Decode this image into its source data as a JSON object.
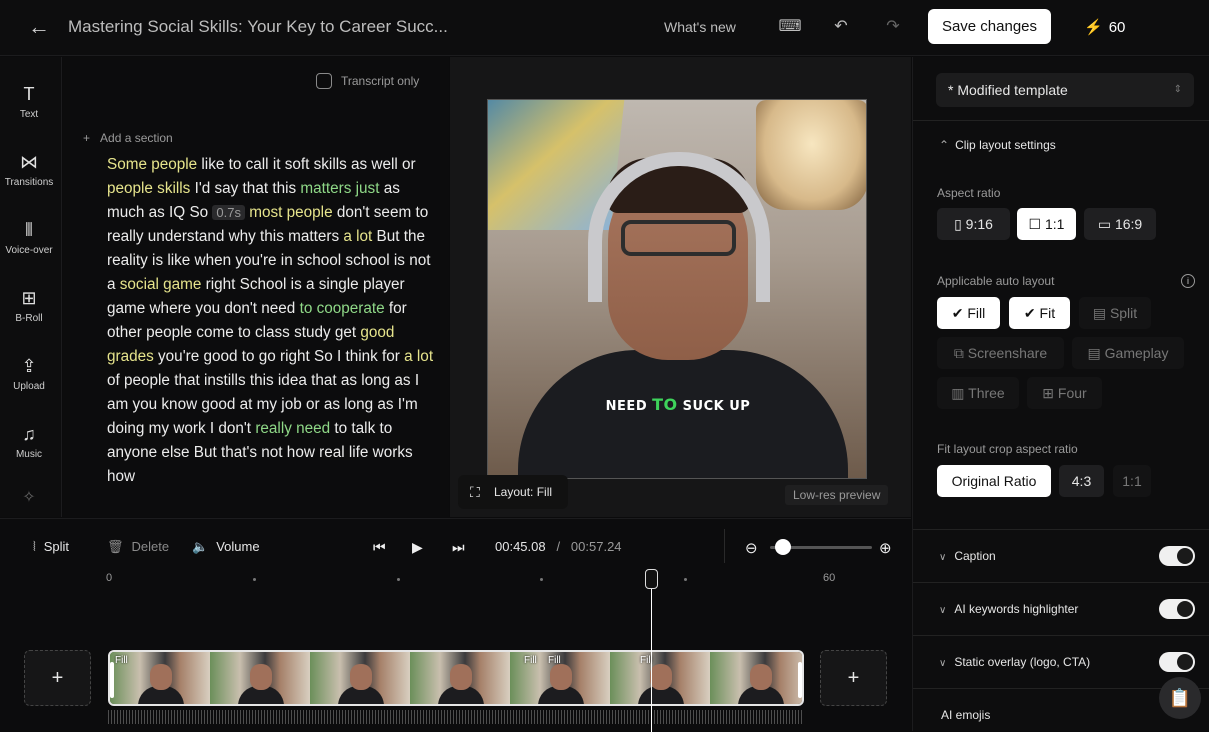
{
  "header": {
    "title": "Mastering Social Skills: Your Key to Career Succ...",
    "whats_new": "What's new",
    "save_label": "Save changes",
    "credits": "60"
  },
  "leftnav": {
    "items": [
      {
        "label": "Text",
        "icon": "T"
      },
      {
        "label": "Transitions",
        "icon": "⋈"
      },
      {
        "label": "Voice-over",
        "icon": "⦀"
      },
      {
        "label": "B-Roll",
        "icon": "⊞"
      },
      {
        "label": "Upload",
        "icon": "⇪"
      },
      {
        "label": "Music",
        "icon": "♫"
      }
    ]
  },
  "transcript": {
    "transcript_only_label": "Transcript only",
    "add_section_label": "Add a section",
    "pause_tag": "0.7s",
    "segments": [
      {
        "t": "Some people",
        "c": "y"
      },
      {
        "t": " like to call it soft skills as well or ",
        "c": ""
      },
      {
        "t": "people skills",
        "c": "y"
      },
      {
        "t": " I'd say that this ",
        "c": ""
      },
      {
        "t": "matters just",
        "c": "g"
      },
      {
        "t": " as much as IQ So ",
        "c": ""
      },
      {
        "t": "0.7s",
        "c": "tag"
      },
      {
        "t": " ",
        "c": ""
      },
      {
        "t": "most people",
        "c": "y"
      },
      {
        "t": " don't seem to really understand why this matters ",
        "c": ""
      },
      {
        "t": "a lot",
        "c": "y"
      },
      {
        "t": " But the reality is like when you're in school school is not a ",
        "c": ""
      },
      {
        "t": "social game",
        "c": "y"
      },
      {
        "t": " right School is a single player game where you don't need ",
        "c": ""
      },
      {
        "t": "to cooperate",
        "c": "g"
      },
      {
        "t": " for other people come to class study get ",
        "c": ""
      },
      {
        "t": "good grades",
        "c": "y"
      },
      {
        "t": " you're good to go right So I think for ",
        "c": ""
      },
      {
        "t": "a lot",
        "c": "y"
      },
      {
        "t": " of people that instills this idea that as long as I am you know good at my job or as long as I'm doing my work I don't ",
        "c": ""
      },
      {
        "t": "really need",
        "c": "g"
      },
      {
        "t": " to talk to anyone else But that's not how real life works how",
        "c": ""
      }
    ]
  },
  "preview": {
    "caption_pre": "NEED ",
    "caption_highlight": "TO",
    "caption_post": " SUCK UP",
    "layout_label": "Layout: Fill",
    "lowres_label": "Low-res preview"
  },
  "panel": {
    "template": "* Modified template",
    "clip_layout_title": "Clip layout settings",
    "aspect_ratio_label": "Aspect ratio",
    "aspect_options": [
      "9:16",
      "1:1",
      "16:9"
    ],
    "auto_layout_label": "Applicable auto layout",
    "layouts": [
      "Fill",
      "Fit",
      "Split",
      "Screenshare",
      "Gameplay",
      "Three",
      "Four"
    ],
    "crop_label": "Fit layout crop aspect ratio",
    "crop_options": [
      "Original Ratio",
      "4:3",
      "1:1"
    ],
    "caption_label": "Caption",
    "keywords_label": "AI keywords highlighter",
    "overlay_label": "Static overlay (logo, CTA)",
    "emojis_label": "AI emojis"
  },
  "timeline": {
    "split": "Split",
    "delete": "Delete",
    "volume": "Volume",
    "current_time": "00:45.08",
    "separator": "/",
    "total_time": "00:57.24",
    "ruler_start": "0",
    "ruler_end": "60",
    "fill_labels": [
      "Fill",
      "Fill",
      "Fill",
      "Fill"
    ]
  },
  "colors": {
    "highlight_yellow": "#e6e48c",
    "highlight_green": "#8fd887",
    "caption_green": "#3ed35b",
    "bolt": "#f5b300"
  }
}
